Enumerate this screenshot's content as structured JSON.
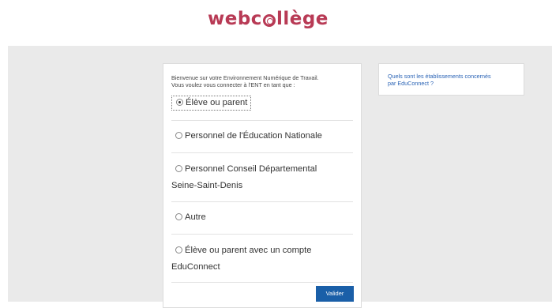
{
  "header": {
    "logo_part1": "webc",
    "logo_part2": "llège"
  },
  "login": {
    "intro_line1": "Bienvenue sur votre Environnement Numérique de Travail.",
    "intro_line2": "Vous voulez vous connecter à l'ENT en tant que :",
    "options": [
      {
        "label": "Élève ou parent",
        "selected": true
      },
      {
        "label": "Personnel de l'Éducation Nationale",
        "selected": false
      },
      {
        "label": "Personnel Conseil Départemental",
        "label2": "Seine-Saint-Denis",
        "selected": false
      },
      {
        "label": "Autre",
        "selected": false
      },
      {
        "label": "Élève ou parent avec un compte",
        "label2": "EduConnect",
        "selected": false
      }
    ],
    "submit_label": "Valider"
  },
  "sidebar": {
    "link_line1": "Quels sont les établissements concernés",
    "link_line2": "par EduConnect ?"
  },
  "colors": {
    "brand": "#b83a55",
    "button": "#1a5fa8",
    "link": "#2a63b5",
    "background": "#eaeaea"
  }
}
